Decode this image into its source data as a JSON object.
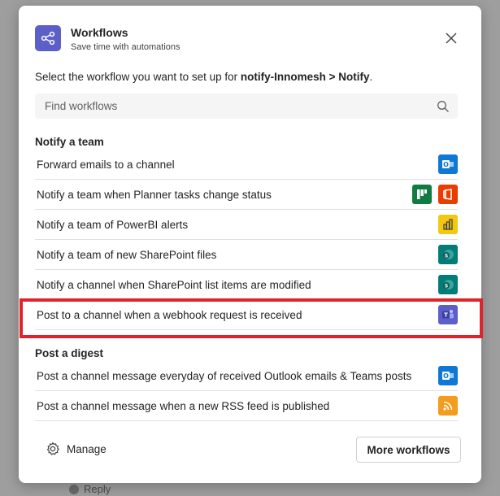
{
  "dialog": {
    "title": "Workflows",
    "subtitle": "Save time with automations",
    "instructions_prefix": "Select the workflow you want to set up for ",
    "instructions_target": "notify-Innomesh > Notify",
    "instructions_suffix": "."
  },
  "search": {
    "placeholder": "Find workflows",
    "value": ""
  },
  "sections": [
    {
      "heading": "Notify a team",
      "items": [
        {
          "label": "Forward emails to a channel",
          "icons": [
            "outlook-icon"
          ]
        },
        {
          "label": "Notify a team when Planner tasks change status",
          "icons": [
            "planner-icon",
            "office-icon"
          ]
        },
        {
          "label": "Notify a team of PowerBI alerts",
          "icons": [
            "powerbi-icon"
          ]
        },
        {
          "label": "Notify a team of new SharePoint files",
          "icons": [
            "sharepoint-icon"
          ]
        },
        {
          "label": "Notify a channel when SharePoint list items are modified",
          "icons": [
            "sharepoint-icon"
          ]
        },
        {
          "label": "Post to a channel when a webhook request is received",
          "icons": [
            "teams-icon"
          ]
        }
      ]
    },
    {
      "heading": "Post a digest",
      "items": [
        {
          "label": "Post a channel message everyday of received Outlook emails & Teams posts",
          "icons": [
            "outlook-icon"
          ]
        },
        {
          "label": "Post a channel message when a new RSS feed is published",
          "icons": [
            "rss-icon"
          ]
        }
      ]
    }
  ],
  "footer": {
    "manage_label": "Manage",
    "more_label": "More workflows"
  },
  "backdrop": {
    "peek_text": "Reply"
  },
  "colors": {
    "accent": "#5b5fc7",
    "outlook": "#0f78d4",
    "planner": "#107c41",
    "office": "#eb3c00",
    "powerbi": "#f2c811",
    "sharepoint": "#037c78",
    "teams": "#5b5fc7",
    "rss": "#f49c1b",
    "highlight": "#e0222b"
  }
}
